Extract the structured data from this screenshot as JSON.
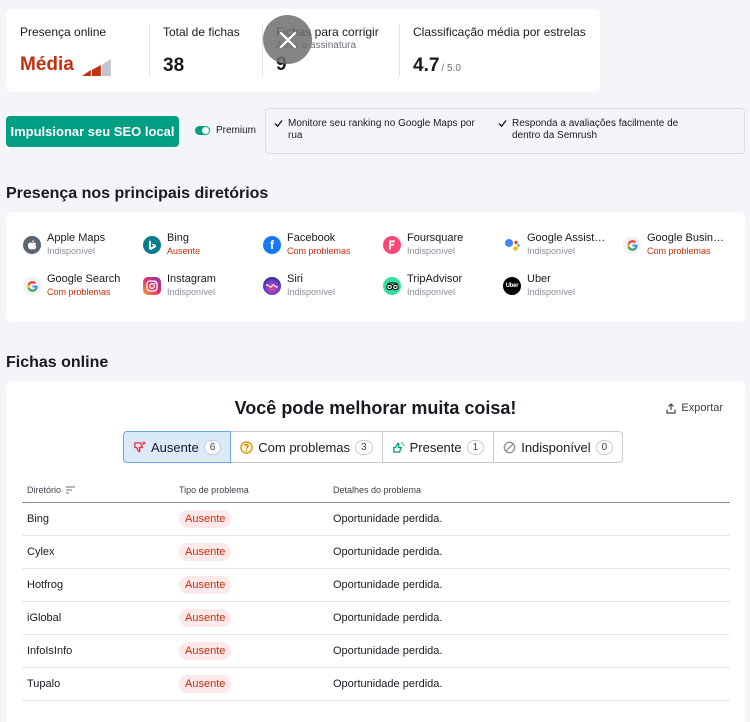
{
  "stats": {
    "presence": {
      "label": "Presença online",
      "value": "Média",
      "color": "#c4300e"
    },
    "total": {
      "label": "Total de fichas",
      "value": "38"
    },
    "fix": {
      "label": "Fichas para corrigir",
      "sub": "Após a assinatura",
      "value": "9"
    },
    "rating": {
      "label": "Classificação média por estrelas",
      "value": "4.7",
      "max": "/ 5.0"
    }
  },
  "actions": {
    "boost_label": "Impulsionar seu SEO local",
    "premium_label": "Premium",
    "benefits": [
      "Monitore seu ranking no Google Maps por rua",
      "Responda a avaliações facilmente de dentro da Semrush"
    ]
  },
  "directories": {
    "title": "Presença nos principais diretórios",
    "items": [
      {
        "name": "Apple Maps",
        "status": "Indisponível",
        "icon": "apple-icon"
      },
      {
        "name": "Bing",
        "status": "Ausente",
        "icon": "bing-icon"
      },
      {
        "name": "Facebook",
        "status": "Com problemas",
        "icon": "facebook-icon"
      },
      {
        "name": "Foursquare",
        "status": "Indisponível",
        "icon": "foursquare-icon"
      },
      {
        "name": "Google Assist…",
        "status": "Indisponível",
        "icon": "google-assistant-icon"
      },
      {
        "name": "Google Busin…",
        "status": "Com problemas",
        "icon": "google-icon"
      },
      {
        "name": "Google Search",
        "status": "Com problemas",
        "icon": "google-icon"
      },
      {
        "name": "Instagram",
        "status": "Indisponível",
        "icon": "instagram-icon"
      },
      {
        "name": "Siri",
        "status": "Indisponível",
        "icon": "siri-icon"
      },
      {
        "name": "TripAdvisor",
        "status": "Indisponível",
        "icon": "tripadvisor-icon"
      },
      {
        "name": "Uber",
        "status": "Indisponível",
        "icon": "uber-icon"
      }
    ]
  },
  "listings": {
    "title": "Fichas online",
    "heading": "Você pode melhorar muita coisa!",
    "export_label": "Exportar",
    "tabs": [
      {
        "label": "Ausente",
        "count": "6"
      },
      {
        "label": "Com problemas",
        "count": "3"
      },
      {
        "label": "Presente",
        "count": "1"
      },
      {
        "label": "Indisponível",
        "count": "0"
      }
    ],
    "columns": [
      "Diretório",
      "Tipo de problema",
      "Detalhes do problema"
    ],
    "rows": [
      {
        "directory": "Bing",
        "type": "Ausente",
        "details": "Oportunidade perdida."
      },
      {
        "directory": "Cylex",
        "type": "Ausente",
        "details": "Oportunidade perdida."
      },
      {
        "directory": "Hotfrog",
        "type": "Ausente",
        "details": "Oportunidade perdida."
      },
      {
        "directory": "iGlobal",
        "type": "Ausente",
        "details": "Oportunidade perdida."
      },
      {
        "directory": "InfoIsInfo",
        "type": "Ausente",
        "details": "Oportunidade perdida."
      },
      {
        "directory": "Tupalo",
        "type": "Ausente",
        "details": "Oportunidade perdida."
      }
    ]
  }
}
